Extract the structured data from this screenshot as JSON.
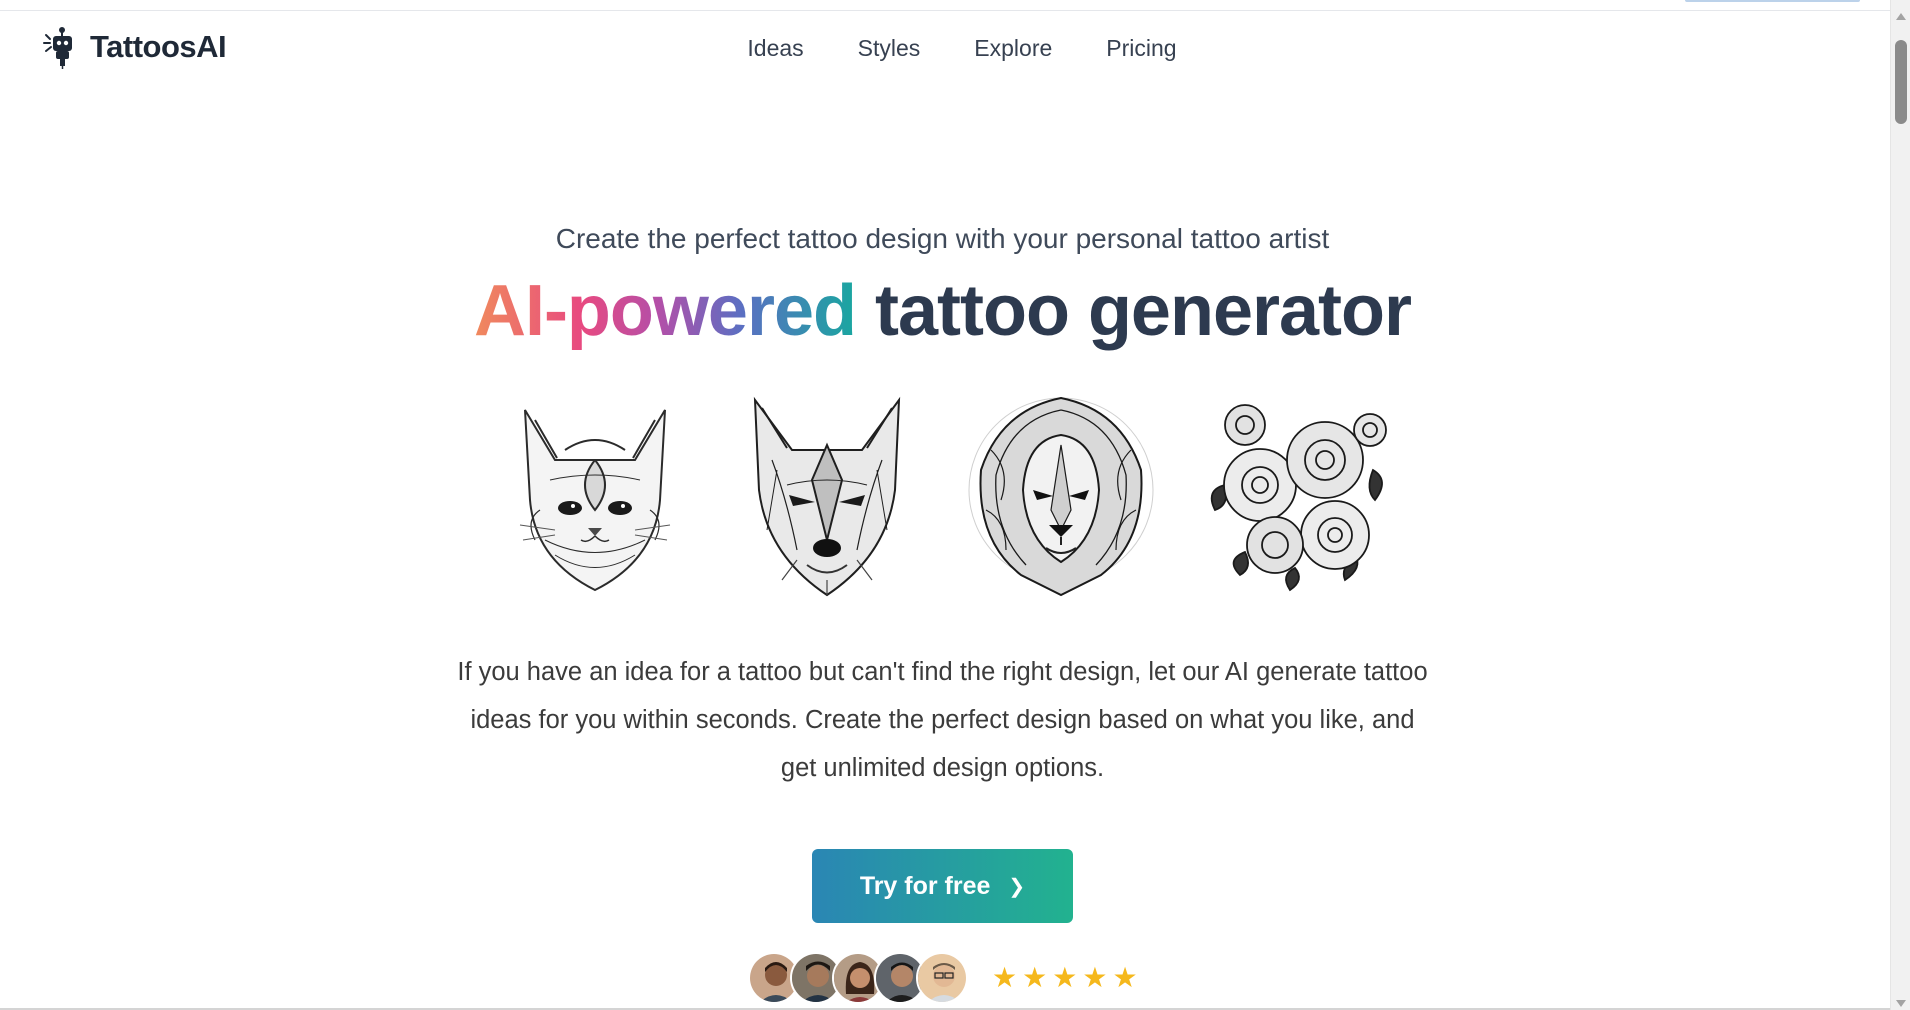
{
  "brand": {
    "name": "TattoosAI",
    "logo_icon": "robot-tattoo-machine-icon"
  },
  "nav": {
    "items": [
      {
        "label": "Ideas"
      },
      {
        "label": "Styles"
      },
      {
        "label": "Explore"
      },
      {
        "label": "Pricing"
      }
    ]
  },
  "hero": {
    "subtitle": "Create the perfect tattoo design with your personal tattoo artist",
    "title_highlight": "AI-powered",
    "title_rest": "tattoo generator",
    "gradient": [
      "#f08a5d",
      "#e84a80",
      "#b44fa8",
      "#5b6fc2",
      "#19a7a0"
    ],
    "title_color": "#2d3a4f"
  },
  "gallery": [
    {
      "subject": "cat"
    },
    {
      "subject": "wolf"
    },
    {
      "subject": "lion"
    },
    {
      "subject": "roses"
    }
  ],
  "description": "If you have an idea for a tattoo but can't find the right design, let our AI generate tattoo ideas for you within seconds. Create the perfect design based on what you like, and get unlimited design options.",
  "cta": {
    "label": "Try for free",
    "icon": "chevron-right-icon",
    "gradient": [
      "#2a86b4",
      "#22b28f"
    ]
  },
  "social_proof": {
    "avatar_count": 5,
    "rating": 5,
    "star_color": "#f5b81c"
  }
}
